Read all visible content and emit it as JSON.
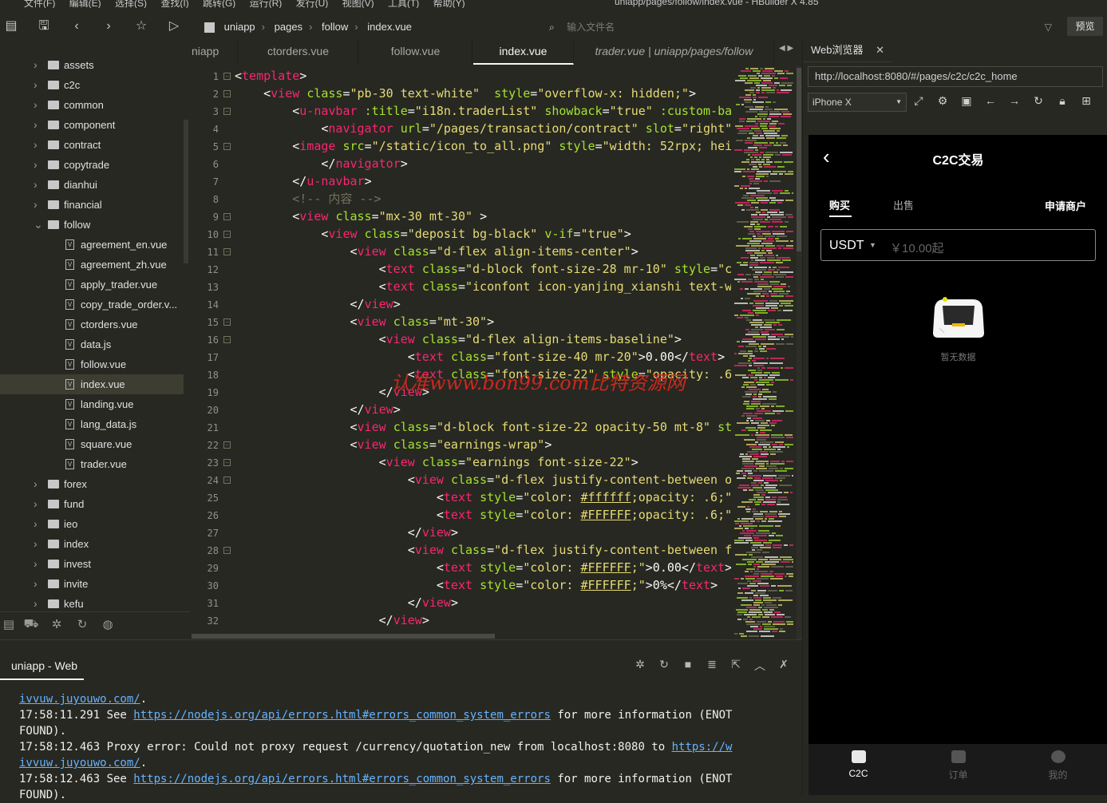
{
  "window": {
    "menu": "文件(F) 编辑(E) 选择(S) 查找(I) 跳转(G) 运行(R) 发行(U) 视图(V) 工具(T) 帮助(Y)",
    "title": "uniapp/pages/follow/index.vue - HBuilder X 4.85"
  },
  "toolbar": {
    "breadcrumb": [
      "uniapp",
      "pages",
      "follow",
      "index.vue"
    ],
    "search_placeholder": "输入文件名",
    "preview": "预览"
  },
  "sidebar": {
    "items": [
      {
        "label": "assets",
        "type": "folder",
        "expanded": false
      },
      {
        "label": "c2c",
        "type": "folder",
        "expanded": false
      },
      {
        "label": "common",
        "type": "folder",
        "expanded": false
      },
      {
        "label": "component",
        "type": "folder",
        "expanded": false
      },
      {
        "label": "contract",
        "type": "folder",
        "expanded": false
      },
      {
        "label": "copytrade",
        "type": "folder",
        "expanded": false
      },
      {
        "label": "dianhui",
        "type": "folder",
        "expanded": false
      },
      {
        "label": "financial",
        "type": "folder",
        "expanded": false
      },
      {
        "label": "follow",
        "type": "folder",
        "expanded": true
      },
      {
        "label": "agreement_en.vue",
        "type": "file"
      },
      {
        "label": "agreement_zh.vue",
        "type": "file"
      },
      {
        "label": "apply_trader.vue",
        "type": "file"
      },
      {
        "label": "copy_trade_order.v...",
        "type": "file"
      },
      {
        "label": "ctorders.vue",
        "type": "file"
      },
      {
        "label": "data.js",
        "type": "file"
      },
      {
        "label": "follow.vue",
        "type": "file"
      },
      {
        "label": "index.vue",
        "type": "file",
        "selected": true
      },
      {
        "label": "landing.vue",
        "type": "file"
      },
      {
        "label": "lang_data.js",
        "type": "file"
      },
      {
        "label": "square.vue",
        "type": "file"
      },
      {
        "label": "trader.vue",
        "type": "file"
      },
      {
        "label": "forex",
        "type": "folder",
        "expanded": false
      },
      {
        "label": "fund",
        "type": "folder",
        "expanded": false
      },
      {
        "label": "ieo",
        "type": "folder",
        "expanded": false
      },
      {
        "label": "index",
        "type": "folder",
        "expanded": false
      },
      {
        "label": "invest",
        "type": "folder",
        "expanded": false
      },
      {
        "label": "invite",
        "type": "folder",
        "expanded": false
      },
      {
        "label": "kefu",
        "type": "folder",
        "expanded": false
      }
    ]
  },
  "tabs": [
    {
      "label": "niapp"
    },
    {
      "label": "ctorders.vue"
    },
    {
      "label": "follow.vue"
    },
    {
      "label": "index.vue",
      "active": true
    },
    {
      "label": "trader.vue | uniapp/pages/follow",
      "italic": true
    }
  ],
  "editor": {
    "line_numbers": [
      "1",
      "2",
      "3",
      "4",
      "5",
      "6",
      "7",
      "8",
      "9",
      "10",
      "11",
      "12",
      "13",
      "14",
      "15",
      "16",
      "17",
      "18",
      "19",
      "20",
      "21",
      "22",
      "23",
      "24",
      "25",
      "26",
      "27",
      "28",
      "29",
      "30",
      "31",
      "32"
    ]
  },
  "watermark": "认准www.bon99.com比特资源网",
  "console": {
    "title": "uniapp - Web",
    "lines": [
      [
        {
          "t": "ivvuw.juyouwo.com/",
          "link": true
        },
        {
          "t": "."
        }
      ],
      [
        {
          "t": "17:58:11.291 See "
        },
        {
          "t": "https://nodejs.org/api/errors.html#errors_common_system_errors",
          "link": true
        },
        {
          "t": " for more information (ENOT"
        }
      ],
      [
        {
          "t": "FOUND)."
        }
      ],
      [
        {
          "t": "17:58:12.463 Proxy error: Could not proxy request /currency/quotation_new from localhost:8080 to "
        },
        {
          "t": "https://w",
          "link": true
        }
      ],
      [
        {
          "t": "ivvuw.juyouwo.com/",
          "link": true
        },
        {
          "t": "."
        }
      ],
      [
        {
          "t": "17:58:12.463 See "
        },
        {
          "t": "https://nodejs.org/api/errors.html#errors_common_system_errors",
          "link": true
        },
        {
          "t": " for more information (ENOT"
        }
      ],
      [
        {
          "t": "FOUND)."
        }
      ]
    ]
  },
  "browser": {
    "tab": "Web浏览器",
    "url": "http://localhost:8080/#/pages/c2c/c2c_home",
    "device": "iPhone X"
  },
  "phone": {
    "title": "C2C交易",
    "tab_buy": "购买",
    "tab_sell": "出售",
    "apply_merchant": "申请商户",
    "coin": "USDT",
    "amount_placeholder": "￥10.00起",
    "empty_text": "暂无数据",
    "tabbar": [
      {
        "label": "C2C",
        "active": true
      },
      {
        "label": "订单",
        "active": false
      },
      {
        "label": "我的",
        "active": false
      }
    ]
  }
}
